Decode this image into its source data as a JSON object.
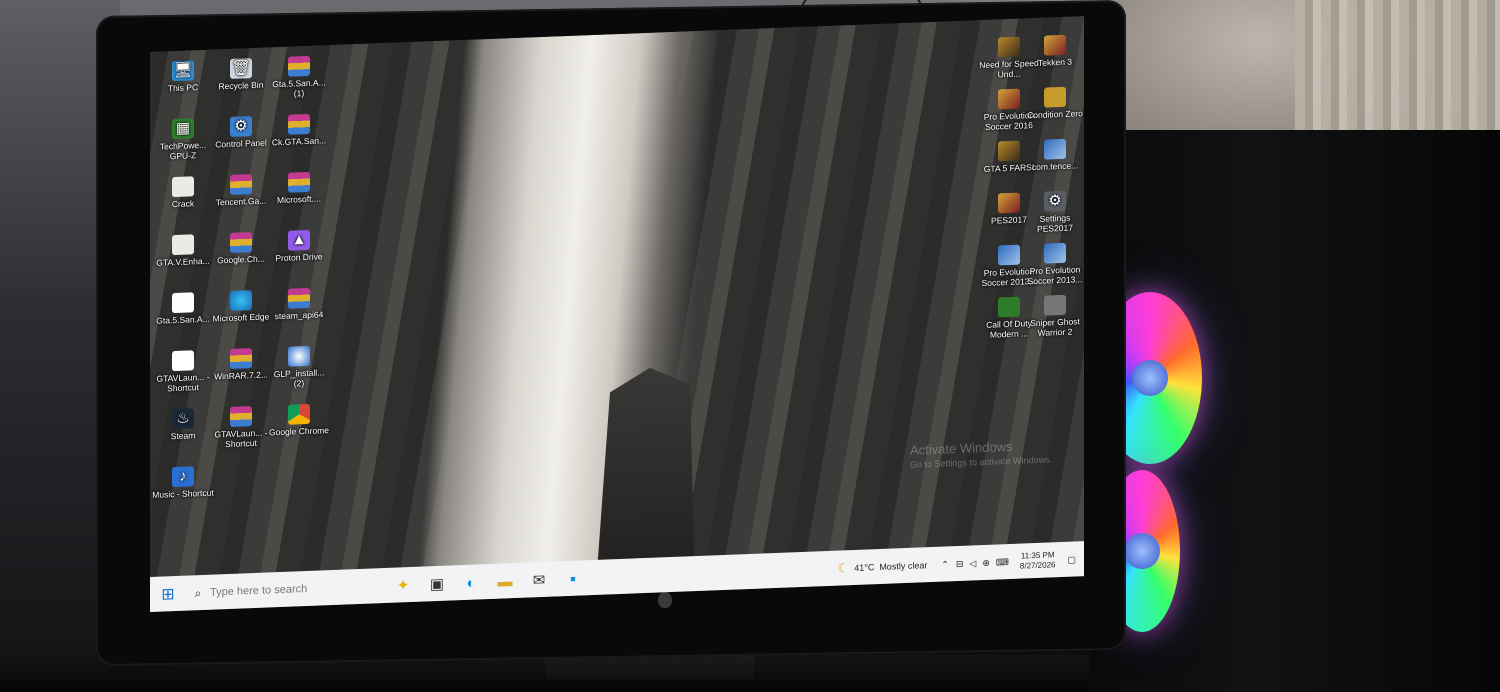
{
  "desktop_icons_left": [
    {
      "label": "This PC",
      "icon": "computer-icon",
      "style": "g-pc",
      "glyph": "🖥"
    },
    {
      "label": "Recycle Bin",
      "icon": "recycle-bin-icon",
      "style": "g-bin",
      "glyph": "🗑"
    },
    {
      "label": "Gta.5.San.A... (1)",
      "icon": "winrar-archive-icon",
      "style": "g-winrar",
      "glyph": ""
    },
    {
      "label": "TechPowe... GPU-Z",
      "icon": "gpu-z-icon",
      "style": "g-gpu",
      "glyph": "▦"
    },
    {
      "label": "Control Panel",
      "icon": "control-panel-icon",
      "style": "g-cp",
      "glyph": "⚙"
    },
    {
      "label": "Ck.GTA.San...",
      "icon": "winrar-archive-icon",
      "style": "g-winrar",
      "glyph": ""
    },
    {
      "label": "Crack",
      "icon": "file-icon",
      "style": "g-file",
      "glyph": ""
    },
    {
      "label": "Tencent.Ga...",
      "icon": "winrar-archive-icon",
      "style": "g-winrar",
      "glyph": ""
    },
    {
      "label": "Microsoft....",
      "icon": "winrar-archive-icon",
      "style": "g-winrar",
      "glyph": ""
    },
    {
      "label": "GTA.V.Enha...",
      "icon": "file-icon",
      "style": "g-file",
      "glyph": ""
    },
    {
      "label": "Google.Ch...",
      "icon": "winrar-archive-icon",
      "style": "g-winrar",
      "glyph": ""
    },
    {
      "label": "Proton Drive",
      "icon": "proton-drive-icon",
      "style": "g-proton",
      "glyph": "▲"
    },
    {
      "label": "Gta.5.San.A...",
      "icon": "shortcut-icon",
      "style": "g-shortcut",
      "glyph": ""
    },
    {
      "label": "Microsoft Edge",
      "icon": "edge-icon",
      "style": "g-edge",
      "glyph": ""
    },
    {
      "label": "steam_api64",
      "icon": "winrar-archive-icon",
      "style": "g-winrar",
      "glyph": ""
    },
    {
      "label": "GTAVLaun... - Shortcut",
      "icon": "shortcut-icon",
      "style": "g-shortcut",
      "glyph": ""
    },
    {
      "label": "WinRAR.7.2...",
      "icon": "winrar-archive-icon",
      "style": "g-winrar",
      "glyph": ""
    },
    {
      "label": "GLP_install... (2)",
      "icon": "installer-icon",
      "style": "g-glp",
      "glyph": ""
    },
    {
      "label": "Steam",
      "icon": "steam-icon",
      "style": "g-steam",
      "glyph": "♨"
    },
    {
      "label": "GTAVLaun... - Shortcut",
      "icon": "winrar-archive-icon",
      "style": "g-winrar",
      "glyph": ""
    },
    {
      "label": "Google Chrome",
      "icon": "chrome-icon",
      "style": "g-chrome",
      "glyph": ""
    },
    {
      "label": "Music - Shortcut",
      "icon": "music-folder-icon",
      "style": "g-music",
      "glyph": "♪"
    }
  ],
  "desktop_icons_right": [
    {
      "label": "Need for Speed Und...",
      "icon": "need-for-speed-icon",
      "style": "g-game",
      "glyph": ""
    },
    {
      "label": "Tekken 3",
      "icon": "tekken-icon",
      "style": "g-game2",
      "glyph": ""
    },
    {
      "label": "Pro Evolution Soccer 2016",
      "icon": "pes-icon",
      "style": "g-game2",
      "glyph": ""
    },
    {
      "label": "Condition Zero",
      "icon": "counter-strike-icon",
      "style": "g-cs",
      "glyph": ""
    },
    {
      "label": "GTA 5 FARSI",
      "icon": "gta-icon",
      "style": "g-game",
      "glyph": ""
    },
    {
      "label": "com.tence...",
      "icon": "game-icon",
      "style": "g-game3",
      "glyph": ""
    },
    {
      "label": "PES2017",
      "icon": "pes-icon",
      "style": "g-game2",
      "glyph": ""
    },
    {
      "label": "Settings PES2017",
      "icon": "settings-icon",
      "style": "g-settings",
      "glyph": "⚙"
    },
    {
      "label": "Pro Evolution Soccer 2013...",
      "icon": "pes-icon",
      "style": "g-game3",
      "glyph": ""
    },
    {
      "label": "Pro Evolution Soccer 2013...",
      "icon": "pes-icon",
      "style": "g-game3",
      "glyph": ""
    },
    {
      "label": "Call Of Duty Modern ...",
      "icon": "call-of-duty-icon",
      "style": "g-cod",
      "glyph": ""
    },
    {
      "label": "Sniper Ghost Warrior 2",
      "icon": "sniper-icon",
      "style": "g-sniper",
      "glyph": ""
    }
  ],
  "watermark": {
    "line1": "Activate Windows",
    "line2": "Go to Settings to activate Windows."
  },
  "taskbar": {
    "search_placeholder": "Type here to search",
    "weather_temp": "41°C",
    "weather_text": "Mostly clear",
    "time": "11:35 PM",
    "date": "8/27/2026"
  }
}
